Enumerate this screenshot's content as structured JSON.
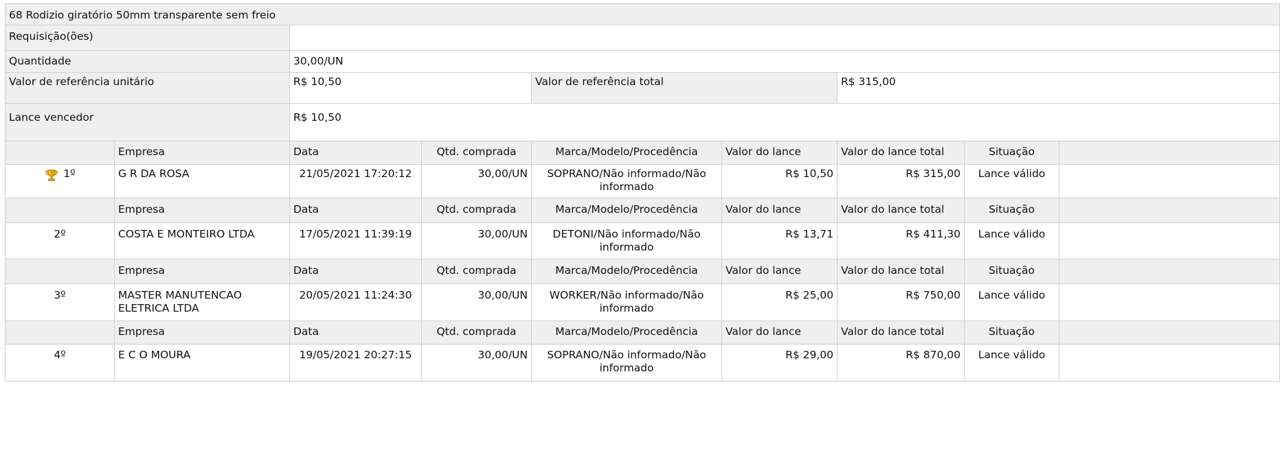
{
  "item": {
    "title": "68 Rodizio giratório 50mm transparente sem freio"
  },
  "info": {
    "requisicoes_label": "Requisição(ões)",
    "requisicoes_value": "",
    "quantidade_label": "Quantidade",
    "quantidade_value": "30,00/UN",
    "ref_unit_label": "Valor de referência unitário",
    "ref_unit_value": "R$ 10,50",
    "ref_total_label": "Valor de referência total",
    "ref_total_value": "R$ 315,00",
    "lance_vencedor_label": "Lance vencedor",
    "lance_vencedor_value": "R$ 10,50"
  },
  "columns": {
    "empresa": "Empresa",
    "data": "Data",
    "qtd": "Qtd. comprada",
    "marca": "Marca/Modelo/Procedência",
    "valor": "Valor do lance",
    "valor_total": "Valor do lance total",
    "situacao": "Situação"
  },
  "bids": [
    {
      "rank": "1º",
      "empresa": "G R DA ROSA",
      "data": "21/05/2021 17:20:12",
      "qtd": "30,00/UN",
      "marca": "SOPRANO/Não informado/Não informado",
      "valor": "R$ 10,50",
      "valor_total": "R$ 315,00",
      "situacao": "Lance válido",
      "icon": "trophy-icon"
    },
    {
      "rank": "2º",
      "empresa": "COSTA E MONTEIRO LTDA",
      "data": "17/05/2021 11:39:19",
      "qtd": "30,00/UN",
      "marca": "DETONI/Não informado/Não informado",
      "valor": "R$ 13,71",
      "valor_total": "R$ 411,30",
      "situacao": "Lance válido"
    },
    {
      "rank": "3º",
      "empresa": "MASTER MANUTENCAO ELETRICA LTDA",
      "data": "20/05/2021 11:24:30",
      "qtd": "30,00/UN",
      "marca": "WORKER/Não informado/Não informado",
      "valor": "R$ 25,00",
      "valor_total": "R$ 750,00",
      "situacao": "Lance válido"
    },
    {
      "rank": "4º",
      "empresa": "E C O MOURA",
      "data": "19/05/2021 20:27:15",
      "qtd": "30,00/UN",
      "marca": "SOPRANO/Não informado/Não informado",
      "valor": "R$ 29,00",
      "valor_total": "R$ 870,00",
      "situacao": "Lance válido"
    }
  ],
  "colors": {
    "header_bg": "#efefef",
    "border": "#cfcfcf",
    "trophy": "#e0a800"
  }
}
